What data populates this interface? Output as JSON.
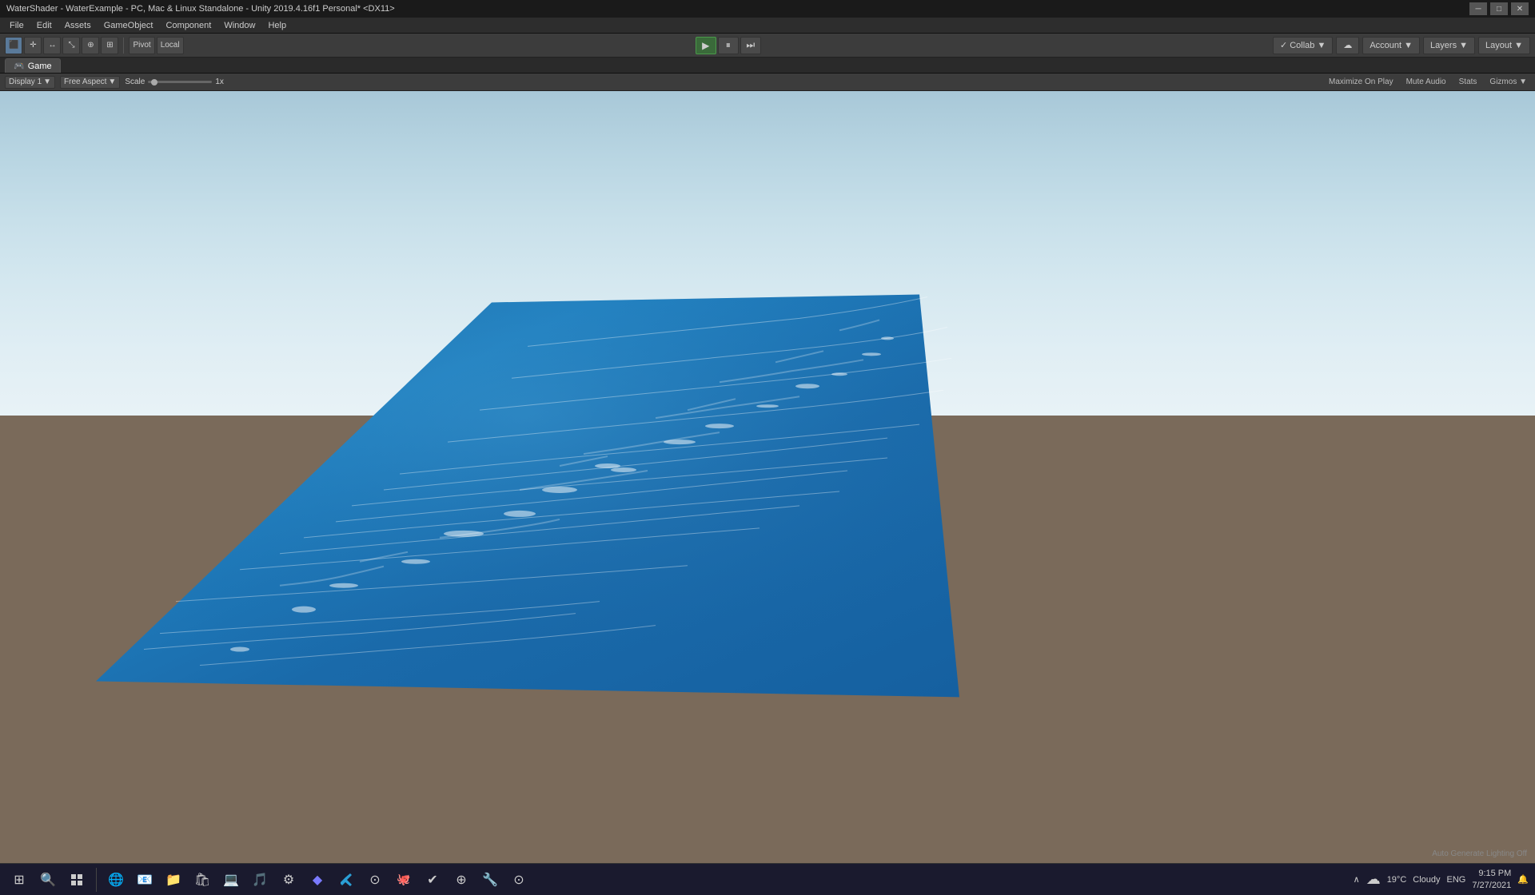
{
  "titleBar": {
    "title": "WaterShader - WaterExample - PC, Mac & Linux Standalone - Unity 2019.4.16f1 Personal* <DX11>",
    "minimize": "─",
    "maximize": "□",
    "close": "✕"
  },
  "menuBar": {
    "items": [
      "File",
      "Edit",
      "Assets",
      "GameObject",
      "Component",
      "Window",
      "Help"
    ]
  },
  "toolbar": {
    "tools": [
      "⬛",
      "✛",
      "↔",
      "⤡",
      "⊕",
      "⊞"
    ],
    "pivot": "Pivot",
    "local": "Local",
    "play": "▶",
    "pause": "⏸",
    "step": "⏭",
    "collab": "Collab ▼",
    "cloud": "☁",
    "account": "Account ▼",
    "layers": "Layers ▼",
    "layout": "Layout ▼"
  },
  "gameTab": {
    "icon": "🎮",
    "label": "Game"
  },
  "viewportToolbar": {
    "display": "Display 1",
    "aspect": "Free Aspect",
    "scale_label": "Scale",
    "scale_value": "1x",
    "right_buttons": [
      "Maximize On Play",
      "Mute Audio",
      "Stats",
      "Gizmos ▼"
    ]
  },
  "viewport": {
    "lighting_notice": "Auto Generate Lighting Off"
  },
  "statusBar": {
    "message": ""
  },
  "taskbar": {
    "icons": [
      "⊞",
      "🔍",
      "🌐",
      "📁",
      "📂",
      "💻",
      "🎵",
      "🔧",
      "◆",
      "📋",
      "U",
      "A",
      "✎",
      "✔",
      "⊕",
      "🔧",
      "⊙"
    ],
    "weather": "☁",
    "temp": "19°C",
    "condition": "Cloudy",
    "lang": "ENG",
    "time": "9:15 PM",
    "date": "7/27/2021",
    "show_hidden": "∧"
  }
}
